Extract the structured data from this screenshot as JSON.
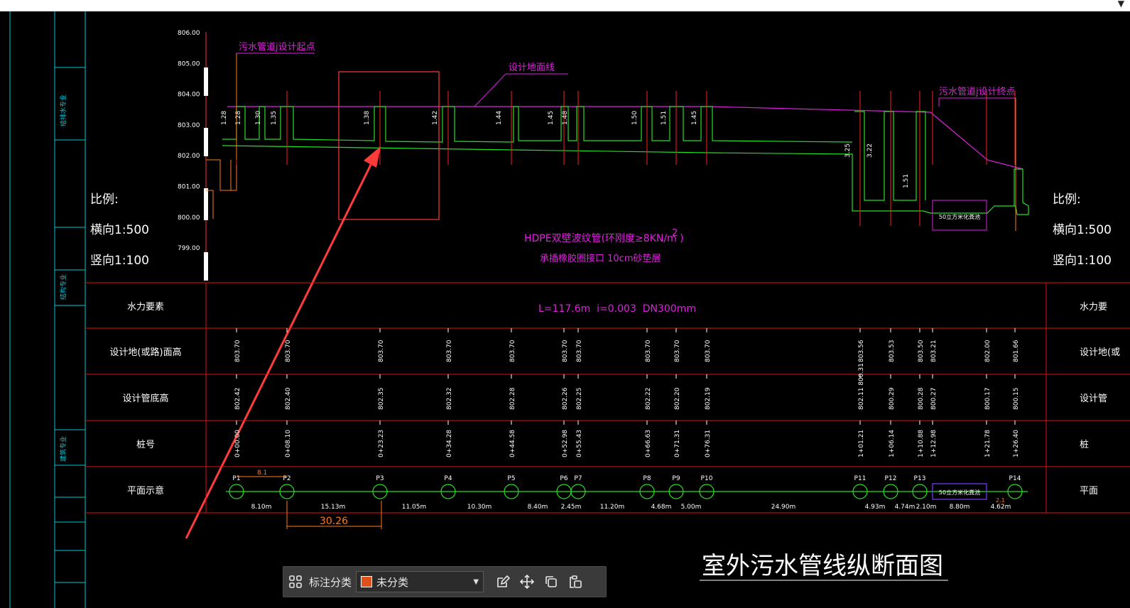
{
  "colors": {
    "background": "#000000",
    "frame": "#00c8d8",
    "table": "#e01010",
    "pipe": "#22e022",
    "magenta": "#e020e0",
    "orange": "#ff7a1a",
    "white": "#ffffff",
    "note_red": "#ff3b3b"
  },
  "elevation_scale": [
    "806.00",
    "805.00",
    "804.00",
    "803.00",
    "802.00",
    "801.00",
    "800.00",
    "799.00"
  ],
  "sidebar_labels": [
    "给排水专业",
    "结构专业",
    "建筑专业"
  ],
  "scale_note": {
    "title": "比例:",
    "horizontal": "横向1:500",
    "vertical": "竖向1:100"
  },
  "callouts": {
    "start": "污水管道j设计起点",
    "ground": "设计地面线",
    "end": "污水管道j设计终点"
  },
  "pipe_spec": {
    "line1": "HDPE双壁波纹管(环刚度≥8KN/m )",
    "superscript": "2",
    "line2": "承插橡胶圈接口 10cm砂垫层"
  },
  "well_depths": [
    "1.28",
    "1.28",
    "1.30",
    "1.35",
    "1.38",
    "1.42",
    "1.44",
    "1.45",
    "1.48",
    "1.50",
    "1.51",
    "1.45",
    "3.25",
    "3.22",
    "1.51"
  ],
  "table": {
    "row_labels": [
      "水力要素",
      "设计地(或路)面高",
      "设计管底高",
      "桩号",
      "平面示意"
    ],
    "right_row_labels": [
      "水力要",
      "设计地(或",
      "设计管",
      "桩",
      "平面"
    ],
    "hydraulic": "L=117.6m  i=0.003  DN300mm",
    "stations": [
      {
        "name": "P1",
        "ground": "803.70",
        "invert": "802.42",
        "chainage": "0+00.00"
      },
      {
        "name": "P2",
        "ground": "803.70",
        "invert": "802.40",
        "chainage": "0+08.10"
      },
      {
        "name": "P3",
        "ground": "803.70",
        "invert": "802.35",
        "chainage": "0+23.23"
      },
      {
        "name": "P4",
        "ground": "803.70",
        "invert": "802.32",
        "chainage": "0+34.28"
      },
      {
        "name": "P5",
        "ground": "803.70",
        "invert": "802.28",
        "chainage": "0+44.58"
      },
      {
        "name": "P6",
        "ground": "803.70",
        "invert": "802.26",
        "chainage": "0+52.98"
      },
      {
        "name": "P7",
        "ground": "803.70",
        "invert": "802.25",
        "chainage": "0+55.43"
      },
      {
        "name": "P8",
        "ground": "803.70",
        "invert": "802.22",
        "chainage": "0+66.63"
      },
      {
        "name": "P9",
        "ground": "803.70",
        "invert": "802.20",
        "chainage": "0+71.31"
      },
      {
        "name": "P10",
        "ground": "803.70",
        "invert": "802.19",
        "chainage": "0+76.31"
      },
      {
        "name": "P11",
        "ground": "803.56",
        "invert": "802.11 800.31",
        "chainage": "1+01.21"
      },
      {
        "name": "P12",
        "ground": "803.53",
        "invert": "800.29",
        "chainage": "1+06.14"
      },
      {
        "name": "P13",
        "ground": "803.50",
        "invert": "800.28",
        "chainage": "1+10.88"
      },
      {
        "name": "",
        "ground": "803.21",
        "invert": "800.27",
        "chainage": "1+12.98"
      },
      {
        "name": "",
        "ground": "802.00",
        "invert": "800.17",
        "chainage": "1+21.78"
      },
      {
        "name": "P14",
        "ground": "801.66",
        "invert": "800.15",
        "chainage": "1+26.40"
      }
    ],
    "segments": [
      "8.10m",
      "15.13m",
      "11.05m",
      "10.30m",
      "8.40m",
      "2.45m",
      "11.20m",
      "4.68m",
      "5.00m",
      "24.90m",
      "4.93m",
      "4.74m",
      "2.10m",
      "8.80m",
      "4.62m"
    ],
    "tank_label": "50立方米化粪池",
    "dim_81": "8.1",
    "dim_small": "2.1",
    "measure": "30.26"
  },
  "drawing_title": "室外污水管线纵断面图",
  "toolbar": {
    "label": "标注分类",
    "selected": "未分类",
    "swatch": "#e0501a"
  }
}
